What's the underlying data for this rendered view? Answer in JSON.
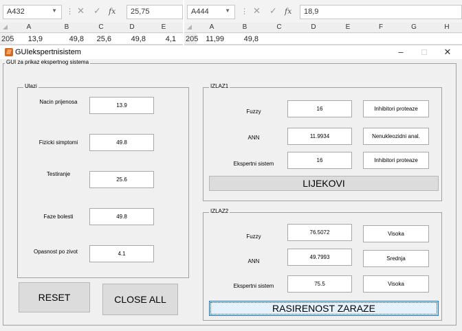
{
  "excel_left": {
    "name_box": "A432",
    "formula_value": "25,75",
    "fx_label": "fx",
    "columns": [
      "A",
      "B",
      "C",
      "D",
      "E"
    ],
    "row_number": "205",
    "cells": [
      "13,9",
      "49,8",
      "25,6",
      "49,8",
      "4,1"
    ]
  },
  "excel_right": {
    "name_box": "A444",
    "formula_value": "18,9",
    "fx_label": "fx",
    "columns": [
      "A",
      "B",
      "C",
      "D",
      "E",
      "F",
      "G",
      "H"
    ],
    "row_number": "205",
    "cells": [
      "11,99",
      "49,8"
    ]
  },
  "window": {
    "title": "GUIekspertnisistem",
    "minimize": "–",
    "maximize": "□",
    "close": "✕"
  },
  "main_panel": {
    "label": "GUI za prikaz ekspertnog sistema"
  },
  "ulazi": {
    "label": "Ulazi",
    "rows": [
      {
        "label": "Nacin prijenosa",
        "value": "13.9"
      },
      {
        "label": "Fizicki simptomi",
        "value": "49.8"
      },
      {
        "label": "Testiranje",
        "value": "25.6"
      },
      {
        "label": "Faze bolesti",
        "value": "49.8"
      },
      {
        "label": "Opasnost po zivot",
        "value": "4.1"
      }
    ]
  },
  "buttons": {
    "reset": "RESET",
    "close_all": "CLOSE ALL"
  },
  "izlaz1": {
    "label": "IZLAZ1",
    "rows": [
      {
        "label": "Fuzzy",
        "value": "16",
        "result": "Inhibitori proteaze"
      },
      {
        "label": "ANN",
        "value": "11.9934",
        "result": "Nenukleozidni anal."
      },
      {
        "label": "Ekspertni sistem",
        "value": "16",
        "result": "Inhibitori proteaze"
      }
    ],
    "button": "LIJEKOVI"
  },
  "izlaz2": {
    "label": "IZLAZ2",
    "rows": [
      {
        "label": "Fuzzy",
        "value": "76.5072",
        "result": "Visoka"
      },
      {
        "label": "ANN",
        "value": "49.7993",
        "result": "Srednja"
      },
      {
        "label": "Ekspertni sistem",
        "value": "75.5",
        "result": "Visoka"
      }
    ],
    "button": "RASIRENOST ZARAZE"
  }
}
